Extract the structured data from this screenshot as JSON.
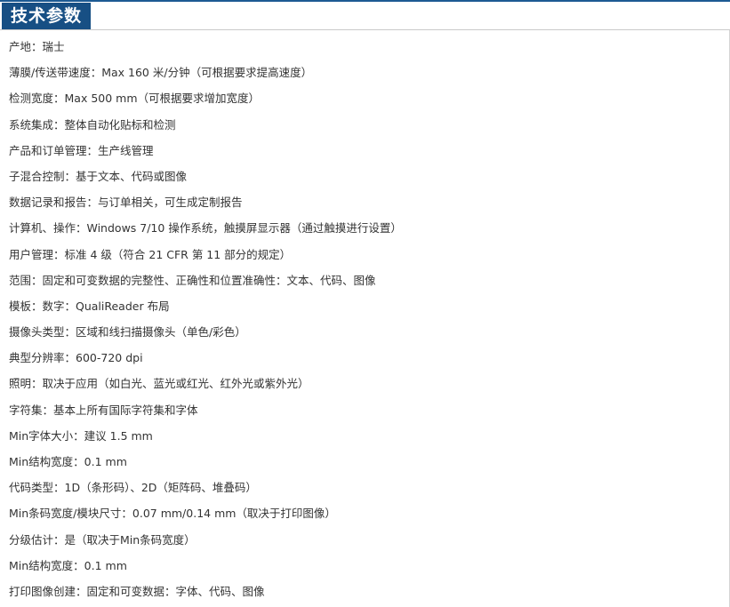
{
  "header": {
    "title": "技术参数"
  },
  "specs": [
    "产地：瑞士",
    "薄膜/传送带速度：Max 160 米/分钟（可根据要求提高速度）",
    "检测宽度：Max 500 mm（可根据要求增加宽度）",
    "系统集成：整体自动化贴标和检测",
    "产品和订单管理：生产线管理",
    "子混合控制：基于文本、代码或图像",
    "数据记录和报告：与订单相关，可生成定制报告",
    "计算机、操作：Windows 7/10 操作系统，触摸屏显示器（通过触摸进行设置）",
    "用户管理：标准 4 级（符合 21 CFR 第 11 部分的规定）",
    "范围：固定和可变数据的完整性、正确性和位置准确性：文本、代码、图像",
    "模板：数字：QualiReader 布局",
    "摄像头类型：区域和线扫描摄像头（单色/彩色）",
    "典型分辨率：600-720 dpi",
    "照明：取决于应用（如白光、蓝光或红光、红外光或紫外光）",
    "字符集：基本上所有国际字符集和字体",
    "Min字体大小：建议 1.5 mm",
    "Min结构宽度：0.1 mm",
    "代码类型：1D（条形码）、2D（矩阵码、堆叠码）",
    "Min条码宽度/模块尺寸：0.07 mm/0.14 mm（取决于打印图像）",
    "分级估计：是（取决于Min条码宽度）",
    "Min结构宽度：0.1 mm",
    "打印图像创建：固定和可变数据：字体、代码、图像"
  ],
  "colors": {
    "header_bg": "#174f84",
    "header_text": "#ffffff",
    "body_text": "#333333"
  }
}
